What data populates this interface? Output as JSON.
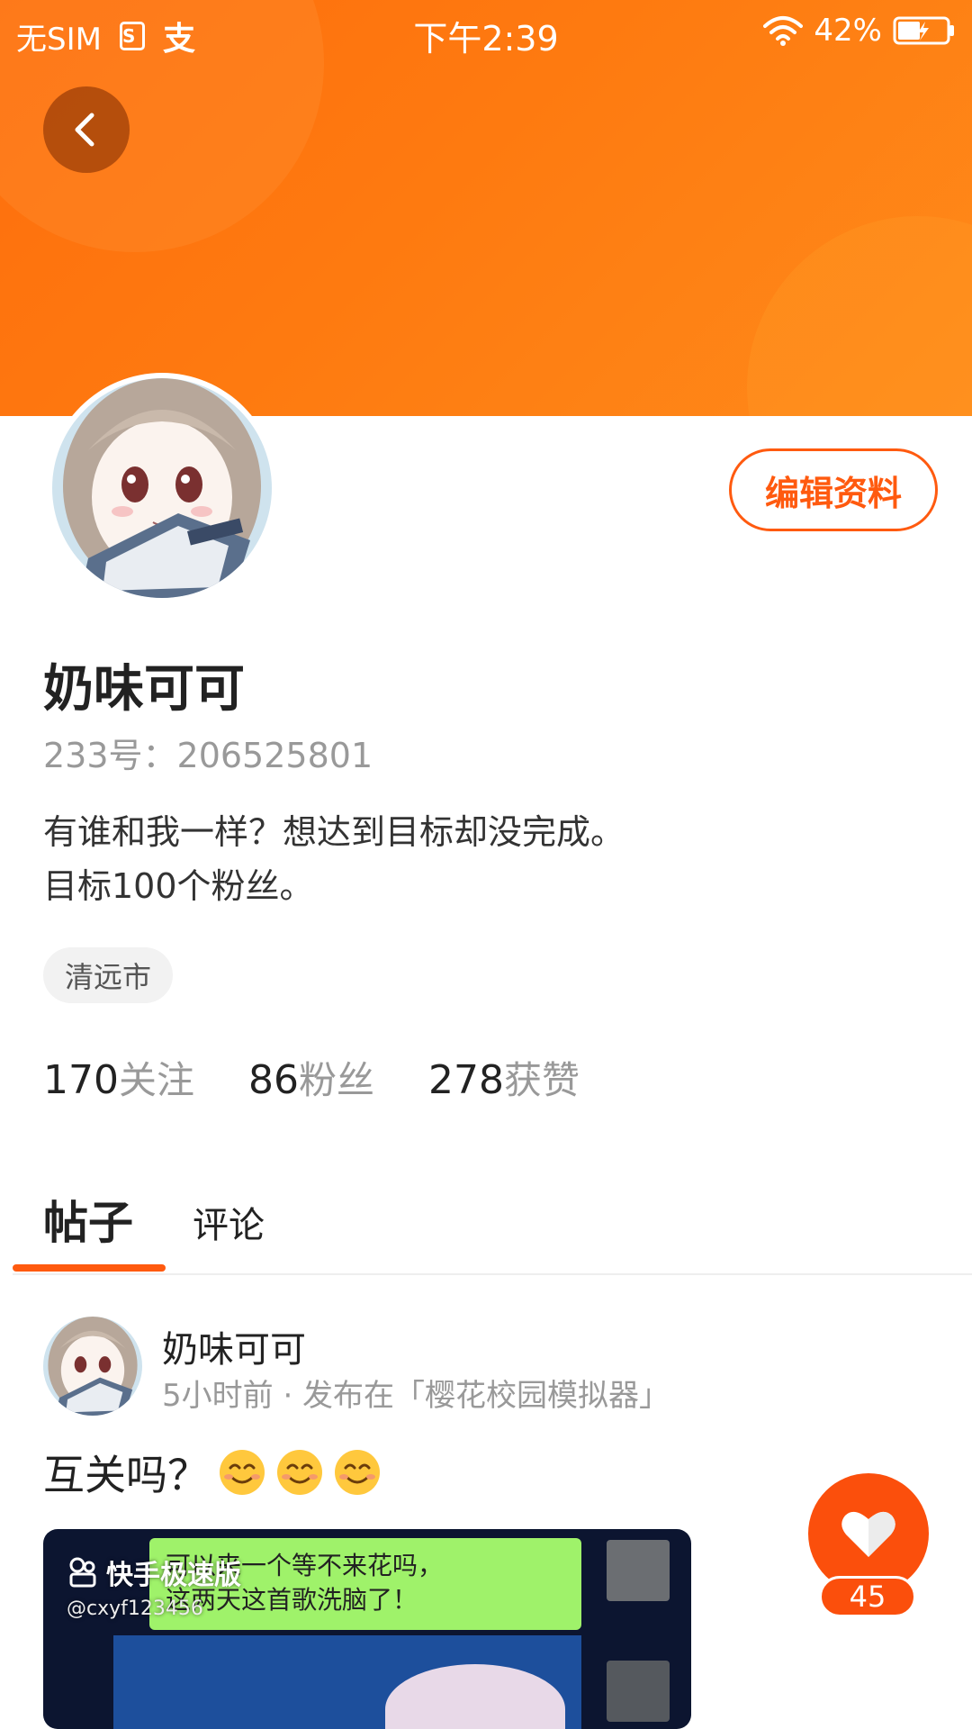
{
  "status_bar": {
    "carrier": "无SIM",
    "time": "下午2:39",
    "battery": "42%",
    "icons": [
      "sim-icon",
      "alipay-icon",
      "wifi-icon",
      "battery-icon"
    ]
  },
  "header": {
    "back_icon": "chevron-left-icon",
    "edit_label": "编辑资料",
    "colors": {
      "accent": "#ff5a0f",
      "header_start": "#fe6e0d",
      "header_end": "#ff8a1a"
    }
  },
  "profile": {
    "name": "奶味可可",
    "uid": "233号：206525801",
    "bio_lines": [
      "有谁和我一样？想达到目标却没完成。",
      "目标100个粉丝。"
    ],
    "location": "清远市",
    "stats": [
      {
        "value": "170",
        "label": "关注"
      },
      {
        "value": "86",
        "label": "粉丝"
      },
      {
        "value": "278",
        "label": "获赞"
      }
    ]
  },
  "tabs": [
    {
      "label": "帖子",
      "active": true
    },
    {
      "label": "评论",
      "active": false
    }
  ],
  "post": {
    "author": "奶味可可",
    "meta": "5小时前 · 发布在「樱花校园模拟器」",
    "text": "互关吗？",
    "emoji_count": 3,
    "video": {
      "logo": "快手极速版",
      "user_id": "@cxyf123456",
      "bubble_lines": [
        "可以来一个等不来花吗，",
        "这两天这首歌洗脑了！"
      ]
    },
    "likes": "45"
  }
}
